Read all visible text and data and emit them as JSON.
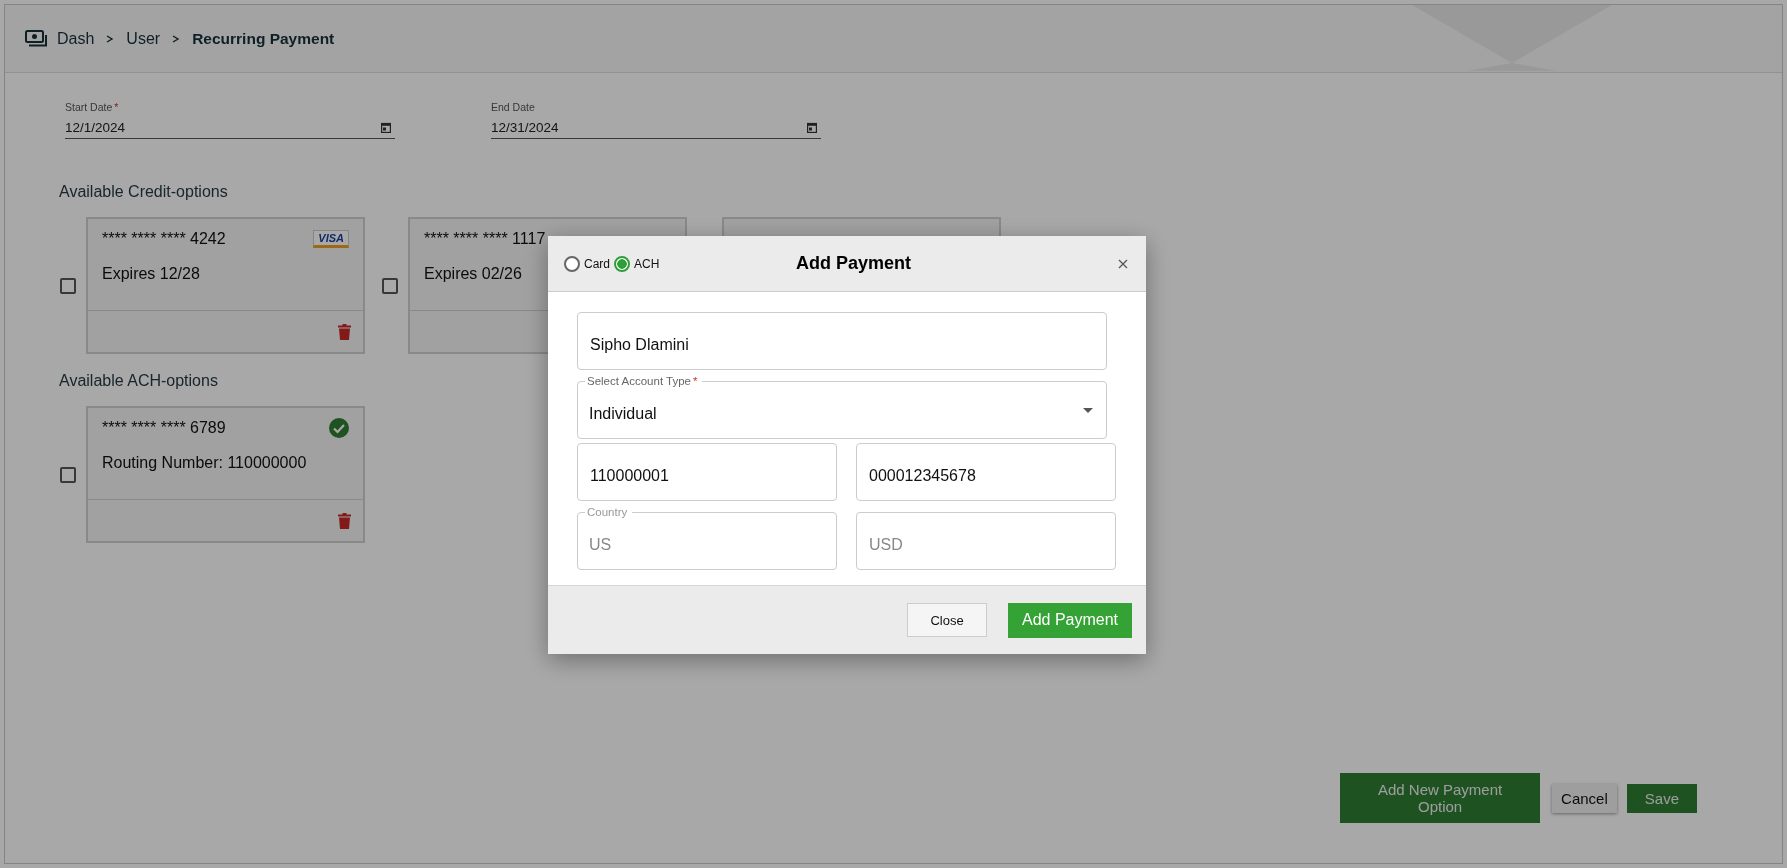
{
  "breadcrumb": [
    {
      "label": "Dash",
      "current": false
    },
    {
      "label": "User",
      "current": false
    },
    {
      "label": "Recurring Payment",
      "current": true
    }
  ],
  "dates": [
    {
      "label": "Start Date",
      "required_mark": "*",
      "value": "12/1/2024"
    },
    {
      "label": "End Date",
      "value": "12/31/2024"
    }
  ],
  "credit_options": {
    "title": "Available Credit-options",
    "cards": [
      {
        "kind": "card",
        "number": "**** **** **** 4242",
        "detail": "Expires 12/28",
        "brand": "VISA",
        "checked": false
      },
      {
        "kind": "cut",
        "number": "**** **** **** 1117",
        "detail": "Expires 02/26",
        "checked": false
      },
      {
        "kind": "covered"
      }
    ]
  },
  "ach_options": {
    "title": "Available ACH-options",
    "cards": [
      {
        "kind": "card",
        "number": "**** **** **** 6789",
        "detail": "Routing Number: 110000000",
        "verified": true,
        "checked": false
      }
    ]
  },
  "actions": [
    {
      "label": "Add New Payment Option",
      "kind": "primary"
    },
    {
      "label": "Cancel",
      "kind": "secondary"
    },
    {
      "label": "Save",
      "kind": "primary"
    }
  ],
  "modal": {
    "title": "Add Payment",
    "methods": [
      {
        "label": "Card",
        "selected": false
      },
      {
        "label": "ACH",
        "selected": true
      }
    ],
    "fields": [
      {
        "kind": "text",
        "value": "Sipho Dlamini",
        "disabled": false
      },
      {
        "kind": "select",
        "label": "Select Account Type",
        "required_mark": "*",
        "value": "Individual",
        "disabled": false
      },
      {
        "kind": "text",
        "value": "110000001",
        "disabled": false
      },
      {
        "kind": "text",
        "value": "000012345678",
        "disabled": false
      },
      {
        "kind": "text",
        "label": "Country",
        "value": "US",
        "disabled": true
      },
      {
        "kind": "text",
        "value": "USD",
        "disabled": true
      }
    ],
    "buttons": [
      {
        "label": "Close",
        "kind": "secondary"
      },
      {
        "label": "Add Payment",
        "kind": "primary"
      }
    ]
  }
}
